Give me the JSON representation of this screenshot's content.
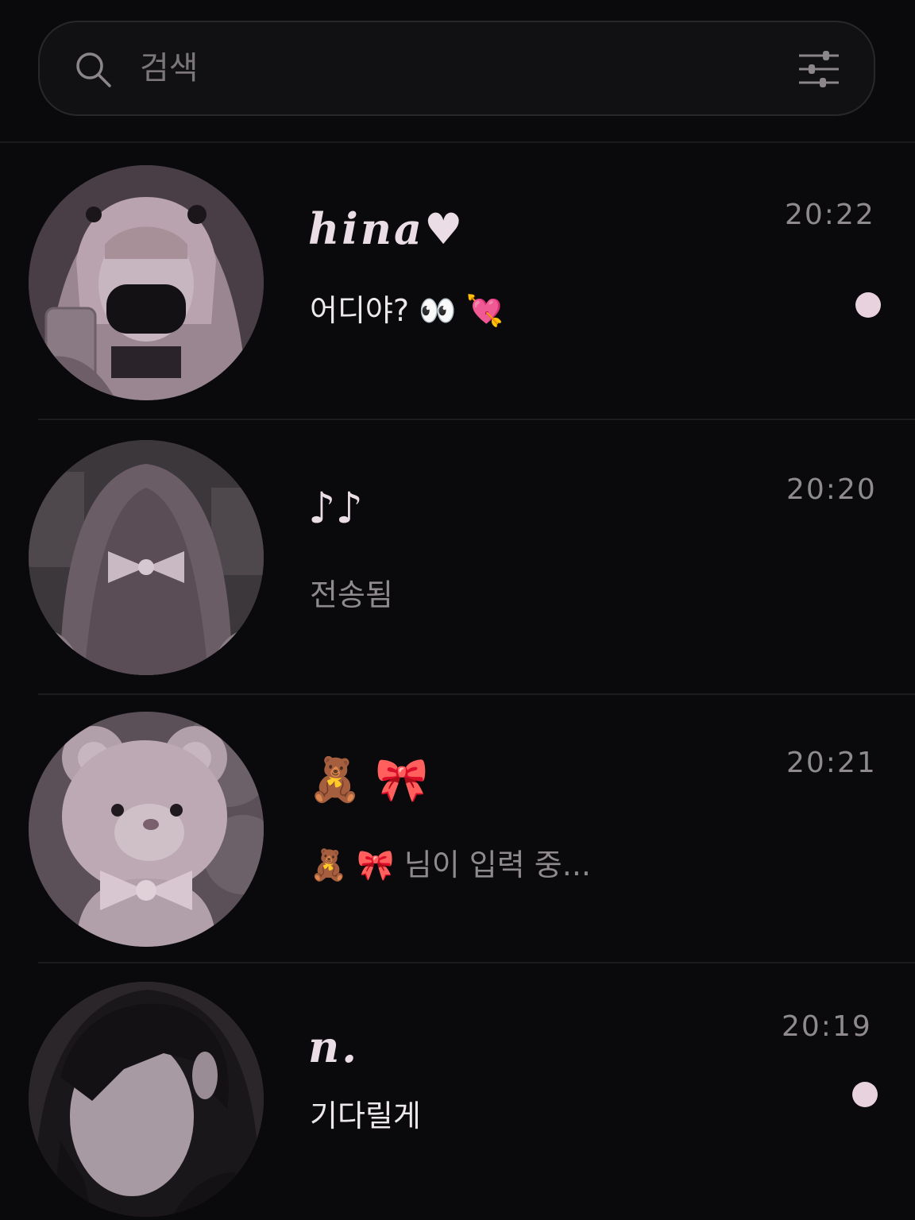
{
  "search": {
    "placeholder": "검색",
    "icon": "search-icon",
    "filter_icon": "sliders-icon"
  },
  "colors": {
    "background": "#0a090b",
    "accent_pink": "#e7d2de",
    "time_gray": "#8e8a8e"
  },
  "chats": [
    {
      "name": "hina♥",
      "time": "20:22",
      "message": "어디야? 👀 💘",
      "unread": true,
      "avatar": "avatar-girl-twintails-mask"
    },
    {
      "name": "♪♪",
      "time": "20:20",
      "message": "전송됨",
      "unread": false,
      "avatar": "avatar-girl-hair-ribbon"
    },
    {
      "name": "🧸 🎀",
      "time": "20:21",
      "message": "🧸 🎀 님이 입력 중...",
      "unread": false,
      "avatar": "avatar-teddy-bear"
    },
    {
      "name": "n.",
      "time": "20:19",
      "message": "기다릴게",
      "unread": true,
      "avatar": "avatar-dark-hair-boy"
    }
  ]
}
